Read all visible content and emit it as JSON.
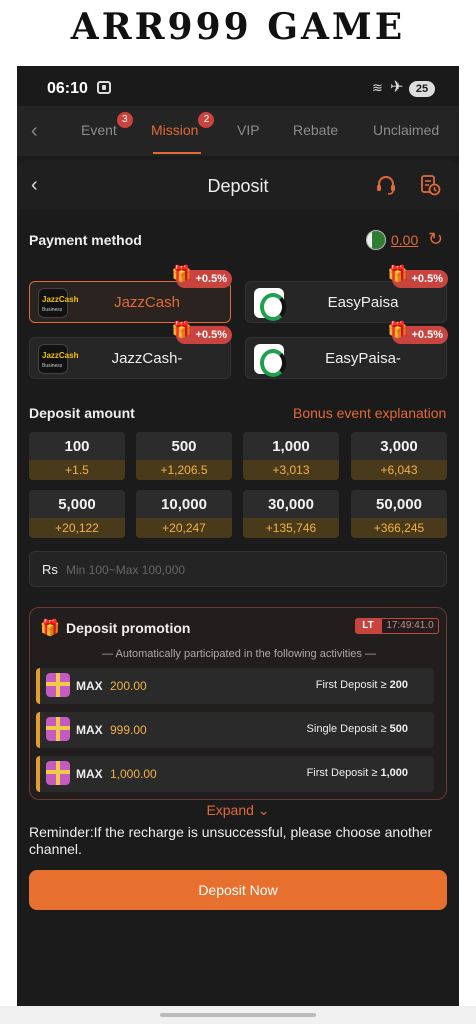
{
  "banner": {
    "title": "ARR999 GAME"
  },
  "status_bar": {
    "time": "06:10",
    "battery": "25"
  },
  "tabs": [
    {
      "label": "Event",
      "badge": "3"
    },
    {
      "label": "Mission",
      "badge": "2",
      "active": true
    },
    {
      "label": "VIP"
    },
    {
      "label": "Rebate"
    },
    {
      "label": "Unclaimed"
    }
  ],
  "header": {
    "title": "Deposit"
  },
  "payment": {
    "label": "Payment method",
    "balance": "0.00",
    "methods": [
      {
        "name": "JazzCash",
        "bonus": "+0.5%",
        "logo_text": "JazzCash",
        "logo_sub": "Business",
        "selected": true
      },
      {
        "name": "EasyPaisa",
        "bonus": "+0.5%"
      },
      {
        "name": "JazzCash-",
        "bonus": "+0.5%",
        "logo_text": "JazzCash",
        "logo_sub": "Business"
      },
      {
        "name": "EasyPaisa-",
        "bonus": "+0.5%"
      }
    ]
  },
  "deposit": {
    "label": "Deposit amount",
    "bonus_link": "Bonus event explanation",
    "amounts": [
      {
        "value": "100",
        "bonus": "+1.5"
      },
      {
        "value": "500",
        "bonus": "+1,206.5"
      },
      {
        "value": "1,000",
        "bonus": "+3,013"
      },
      {
        "value": "3,000",
        "bonus": "+6,043"
      },
      {
        "value": "5,000",
        "bonus": "+20,122"
      },
      {
        "value": "10,000",
        "bonus": "+20,247"
      },
      {
        "value": "30,000",
        "bonus": "+135,746"
      },
      {
        "value": "50,000",
        "bonus": "+366,245"
      }
    ],
    "currency": "Rs",
    "placeholder": "Min 100~Max 100,000"
  },
  "promotion": {
    "title": "Deposit promotion",
    "timer_tag": "LT",
    "timer": "17:49:41.0",
    "subtitle": "— Automatically participated in the following activities —",
    "rows": [
      {
        "max_label": "MAX",
        "max_value": "200.00",
        "condition": "First Deposit ≥",
        "threshold": "200"
      },
      {
        "max_label": "MAX",
        "max_value": "999.00",
        "condition": "Single Deposit ≥",
        "threshold": "500"
      },
      {
        "max_label": "MAX",
        "max_value": "1,000.00",
        "condition": "First Deposit ≥",
        "threshold": "1,000"
      }
    ]
  },
  "expand_label": "Expand",
  "reminder": "Reminder:If the recharge is unsuccessful, please choose another channel.",
  "deposit_button": "Deposit Now",
  "colors": {
    "accent": "#e2693a",
    "bonus": "#f4b04b",
    "badge": "#c9443e",
    "background": "#1b1b1b"
  }
}
